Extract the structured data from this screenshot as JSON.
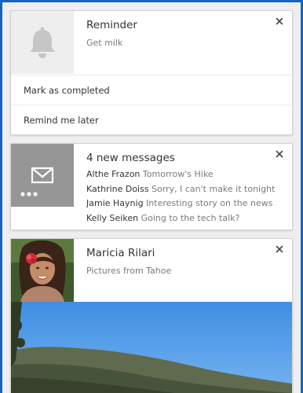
{
  "reminder_card": {
    "title": "Reminder",
    "body": "Get milk",
    "icon": "bell-icon",
    "actions": [
      {
        "label": "Mark as completed"
      },
      {
        "label": "Remind me later"
      }
    ]
  },
  "messages_card": {
    "title": "4 new messages",
    "icon": "mail-icon",
    "messages": [
      {
        "sender": "Althe Frazon",
        "preview": "Tomorrow's Hike"
      },
      {
        "sender": "Kathrine Doiss",
        "preview": "Sorry, I can't make it tonight"
      },
      {
        "sender": "Jamie Haynig",
        "preview": "Interesting story on the news"
      },
      {
        "sender": "Kelly Seiken",
        "preview": "Going to the tech talk?"
      }
    ]
  },
  "photo_card": {
    "title": "Maricia Rilari",
    "body": "Pictures from Tahoe"
  },
  "close_glyph": "×",
  "colors": {
    "window_border": "#1565c0",
    "panel_background": "#eeeeee",
    "card_background": "#ffffff",
    "mail_icon_background": "#969696",
    "bell_icon_background": "#eeeeee",
    "sky": "#3f8ee2"
  }
}
